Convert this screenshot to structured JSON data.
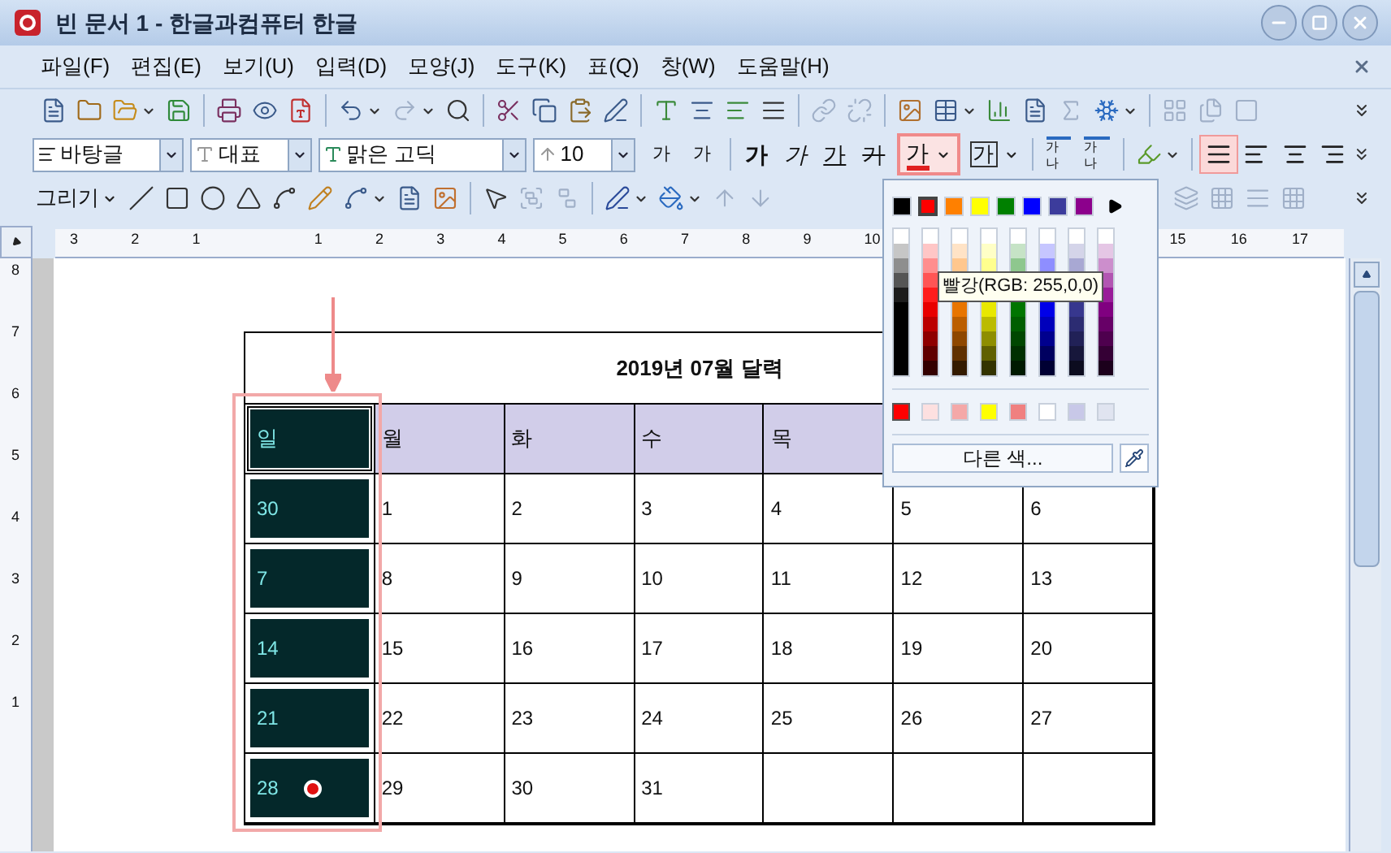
{
  "window": {
    "title": "빈 문서 1 - 한글과컴퓨터 한글"
  },
  "menu": [
    "파일(F)",
    "편집(E)",
    "보기(U)",
    "입력(D)",
    "모양(J)",
    "도구(K)",
    "표(Q)",
    "창(W)",
    "도움말(H)"
  ],
  "format_bar": {
    "style": "바탕글",
    "language": "대표",
    "font": "맑은 고딕",
    "size": "10",
    "size_buttons": [
      "가",
      "가"
    ],
    "char_buttons": [
      {
        "label": "가",
        "kind": "bold"
      },
      {
        "label": "가",
        "kind": "italic"
      },
      {
        "label": "가",
        "kind": "underline"
      },
      {
        "label": "가",
        "kind": "strike"
      }
    ],
    "font_color": {
      "label": "가",
      "expanded": true
    },
    "border_char": "가",
    "spacing_buttons": [
      "가나",
      "가나"
    ],
    "alignment": [
      {
        "selected": true
      },
      {
        "selected": false
      },
      {
        "selected": false
      },
      {
        "selected": false
      }
    ]
  },
  "draw_bar": {
    "menu": "그리기"
  },
  "ruler": {
    "marks": [
      "3",
      "2",
      "1",
      "1",
      "2",
      "3",
      "4",
      "5",
      "6",
      "7",
      "8",
      "9",
      "10",
      "15",
      "16",
      "17"
    ],
    "vertical_marks": [
      "8",
      "7",
      "6",
      "5",
      "4",
      "3",
      "2",
      "1"
    ]
  },
  "calendar": {
    "title": "2019년 07월 달력",
    "header": [
      "일",
      "월",
      "화",
      "수",
      "목"
    ],
    "rows": [
      {
        "cells": [
          "30",
          "1",
          "2",
          "3",
          "4",
          "5",
          "6"
        ],
        "marked": false
      },
      {
        "cells": [
          "7",
          "8",
          "9",
          "10",
          "11",
          "12",
          "13"
        ],
        "marked": false
      },
      {
        "cells": [
          "14",
          "15",
          "16",
          "17",
          "18",
          "19",
          "20"
        ],
        "marked": false
      },
      {
        "cells": [
          "21",
          "22",
          "23",
          "24",
          "25",
          "26",
          "27"
        ],
        "marked": false
      },
      {
        "cells": [
          "28",
          "29",
          "30",
          "31"
        ],
        "marked": true
      }
    ]
  },
  "font_color_popup": {
    "palette": [
      {
        "color": "#000000",
        "selected": false
      },
      {
        "color": "#ff0000",
        "selected": true
      },
      {
        "color": "#ff8000",
        "selected": false
      },
      {
        "color": "#ffff00",
        "selected": false
      },
      {
        "color": "#008000",
        "selected": false
      },
      {
        "color": "#0000ff",
        "selected": false
      },
      {
        "color": "#3c3c9c",
        "selected": false
      },
      {
        "color": "#8c008c",
        "selected": false
      }
    ],
    "recent": [
      {
        "color": "#ff0000",
        "selected": true
      },
      {
        "color": "#fde0e0",
        "selected": false
      },
      {
        "color": "#f4a8a8",
        "selected": false
      },
      {
        "color": "#ffff00",
        "selected": false
      },
      {
        "color": "#f08080",
        "selected": false
      },
      {
        "color": "#ffffff",
        "selected": false
      },
      {
        "color": "#c8c8e8",
        "selected": false
      },
      {
        "color": "#e0e4f0",
        "selected": false
      }
    ],
    "more_button": "다른 색...",
    "tooltip": "빨강(RGB: 255,0,0)"
  }
}
